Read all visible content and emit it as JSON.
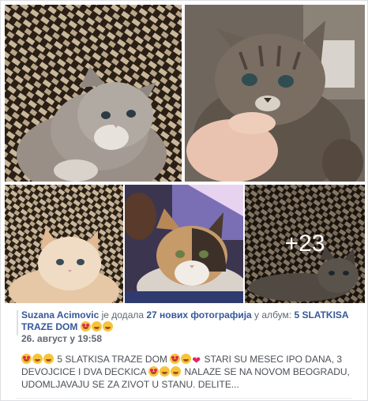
{
  "post": {
    "author": "Suzana Acimovic",
    "added_text": " је додала ",
    "photo_count_link": "27 нових фотографија",
    "album_text": " у албум: ",
    "album_name": "5 SLATKISA TRAZE DOM",
    "date": "26. август у 19:58",
    "description_part1": " 5 SLATKISA TRAZE DOM ",
    "description_part2": " STARI SU MESEC IPO DANA, 3 DEVOJCICE I DVA DECKICA ",
    "description_part3": " NALAZE SE NA NOVOM BEOGRADU, UDOMLJAVAJU SE ZA ZIVOT U STANU. DELITE..."
  },
  "gallery": {
    "photos": [
      {
        "subject": "gray-white-kitten"
      },
      {
        "subject": "tabby-kitten-held"
      },
      {
        "subject": "ginger-white-kitten"
      },
      {
        "subject": "calico-kitten"
      },
      {
        "subject": "tabby-kitten-lying"
      }
    ],
    "more_label": "+23"
  },
  "icons": [
    "heart-eyes-icon",
    "smile-icon",
    "kiss-icon",
    "red-heart-icon"
  ],
  "colors": {
    "link": "#365899",
    "meta": "#616770",
    "text": "#4b4f56"
  }
}
